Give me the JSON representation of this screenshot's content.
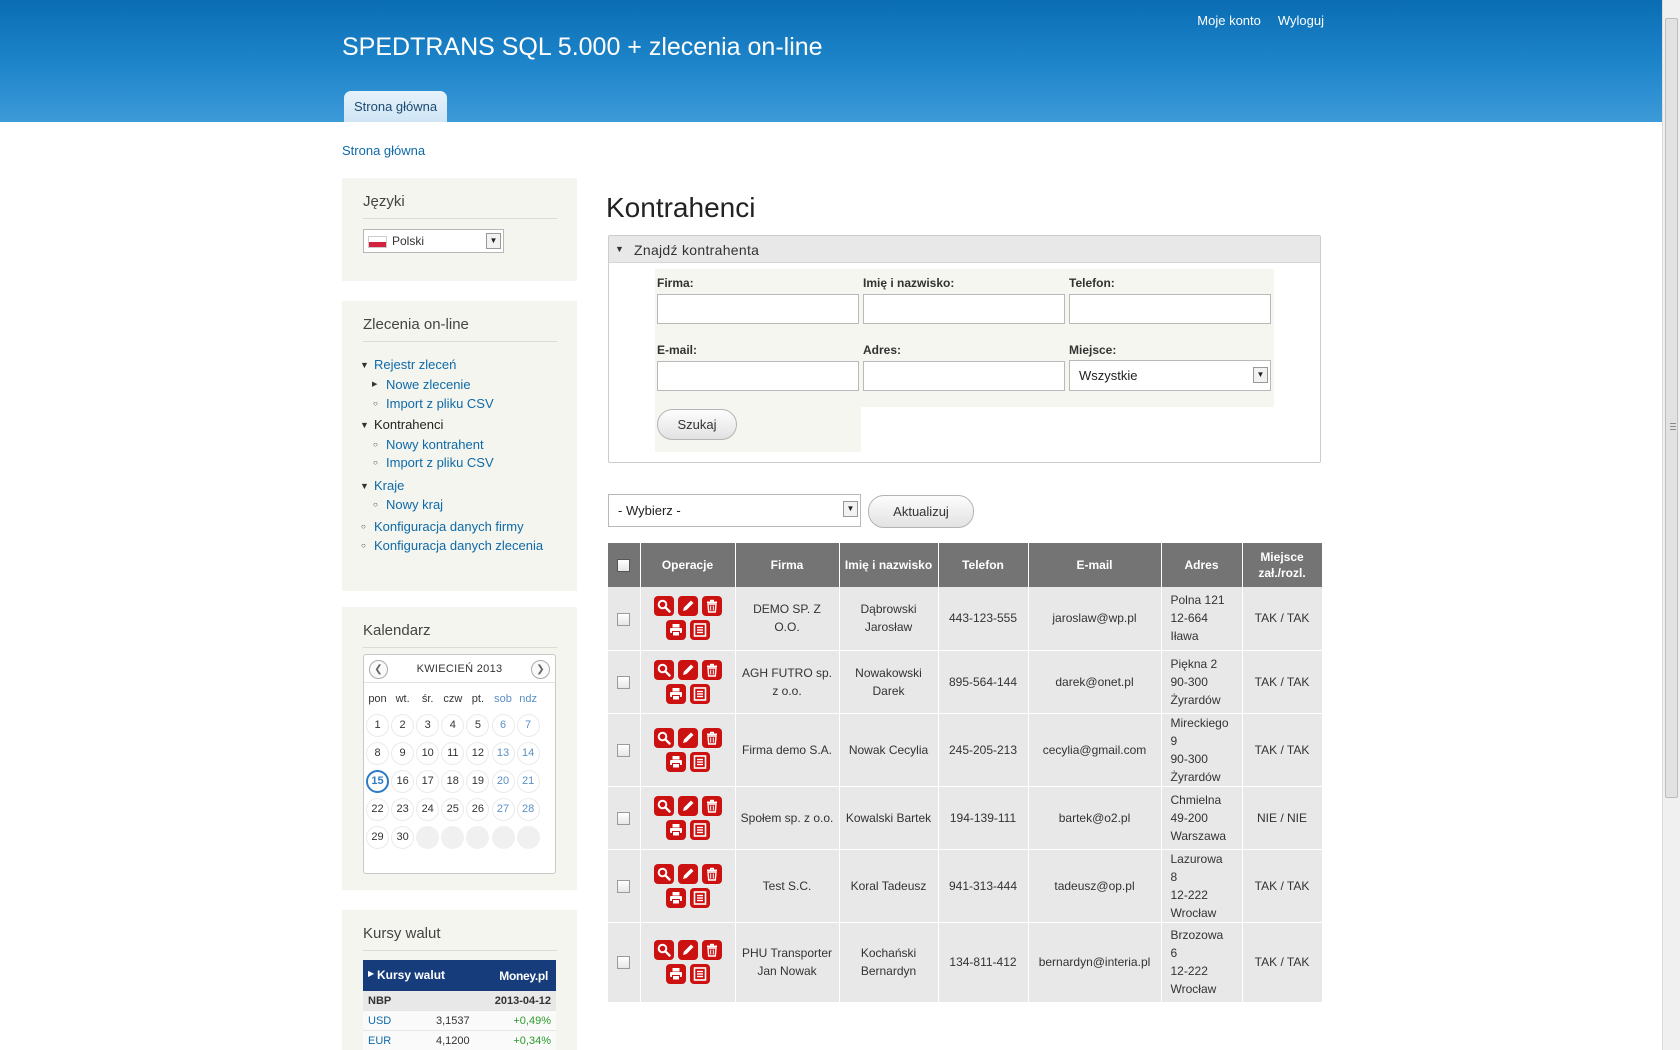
{
  "header": {
    "site_title": "SPEDTRANS SQL 5.000 + zlecenia on-line",
    "user_menu": [
      "Moje konto",
      "Wyloguj"
    ],
    "primary_tab": "Strona główna"
  },
  "breadcrumb": "Strona główna",
  "sidebar": {
    "languages": {
      "title": "Języki",
      "selected": "Polski"
    },
    "orders": {
      "title": "Zlecenia on-line",
      "items": [
        {
          "label": "Rejestr zleceń",
          "level": 0,
          "marker": "expanded",
          "link": true
        },
        {
          "label": "Nowe zlecenie",
          "level": 1,
          "marker": "collapsed",
          "link": true
        },
        {
          "label": "Import z pliku CSV",
          "level": 1,
          "marker": "leaf",
          "link": true
        },
        {
          "label": "Kontrahenci",
          "level": 0,
          "marker": "expanded",
          "link": false
        },
        {
          "label": "Nowy kontrahent",
          "level": 1,
          "marker": "leaf",
          "link": true
        },
        {
          "label": "Import z pliku CSV",
          "level": 1,
          "marker": "leaf",
          "link": true
        },
        {
          "label": "Kraje",
          "level": 0,
          "marker": "expanded",
          "link": true
        },
        {
          "label": "Nowy kraj",
          "level": 1,
          "marker": "leaf",
          "link": true
        },
        {
          "label": "Konfiguracja danych firmy",
          "level": 0,
          "marker": "leaf",
          "link": true
        },
        {
          "label": "Konfiguracja danych zlecenia",
          "level": 0,
          "marker": "leaf",
          "link": true
        }
      ]
    },
    "calendar": {
      "title": "Kalendarz",
      "month": "KWIECIEŃ 2013",
      "weekdays": [
        "pon",
        "wt.",
        "śr.",
        "czw",
        "pt.",
        "sob",
        "ndz"
      ],
      "days_in_month": 30,
      "first_weekday_index": 0,
      "today": 15
    },
    "exchange_rates": {
      "title": "Kursy walut",
      "widget_title": "Kursy walut",
      "brand": "Money.pl",
      "source": "NBP",
      "date": "2013-04-12",
      "rows": [
        {
          "currency": "USD",
          "rate": "3,1537",
          "change": "+0,49%"
        },
        {
          "currency": "EUR",
          "rate": "4,1200",
          "change": "+0,34%"
        }
      ],
      "up_color": "#2a9a2a"
    }
  },
  "main": {
    "heading": "Kontrahenci",
    "filter": {
      "legend": "Znajdź kontrahenta",
      "labels": {
        "company": "Firma:",
        "name": "Imię i nazwisko:",
        "phone": "Telefon:",
        "email": "E-mail:",
        "address": "Adres:",
        "place": "Miejsce:"
      },
      "values": {
        "company": "",
        "name": "",
        "phone": "",
        "email": "",
        "address": ""
      },
      "place_selected": "Wszystkie",
      "search_button": "Szukaj"
    },
    "bulk": {
      "selected": "- Wybierz -",
      "update_button": "Aktualizuj"
    },
    "table": {
      "columns": [
        "Operacje",
        "Firma",
        "Imię i nazwisko",
        "Telefon",
        "E-mail",
        "Adres",
        "Miejsce zał./rozl."
      ],
      "rows": [
        {
          "company": "DEMO SP. Z O.O.",
          "name": "Dąbrowski Jarosław",
          "phone": "443-123-555",
          "email": "jaroslaw@wp.pl",
          "address": [
            "Polna 121",
            "12-664",
            "Iława"
          ],
          "place": "TAK / TAK"
        },
        {
          "company": "AGH FUTRO sp. z o.o.",
          "name": "Nowakowski Darek",
          "phone": "895-564-144",
          "email": "darek@onet.pl",
          "address": [
            "Piękna 2",
            "90-300",
            "Żyrardów"
          ],
          "place": "TAK / TAK"
        },
        {
          "company": "Firma demo S.A.",
          "name": "Nowak Cecylia",
          "phone": "245-205-213",
          "email": "cecylia@gmail.com",
          "address": [
            "Mireckiego",
            "9",
            "90-300",
            "Żyrardów"
          ],
          "place": "TAK / TAK"
        },
        {
          "company": "Społem sp. z o.o.",
          "name": "Kowalski Bartek",
          "phone": "194-139-111",
          "email": "bartek@o2.pl",
          "address": [
            "Chmielna",
            "49-200",
            "Warszawa"
          ],
          "place": "NIE / NIE"
        },
        {
          "company": "Test S.C.",
          "name": "Koral Tadeusz",
          "phone": "941-313-444",
          "email": "tadeusz@op.pl",
          "address": [
            "Lazurowa",
            "8",
            "12-222",
            "Wrocław"
          ],
          "place": "TAK / TAK"
        },
        {
          "company": "PHU Transporter Jan Nowak",
          "name": "Kochański Bernardyn",
          "phone": "134-811-412",
          "email": "bernardyn@interia.pl",
          "address": [
            "Brzozowa",
            "6",
            "12-222",
            "Wrocław"
          ],
          "place": "TAK / TAK"
        }
      ],
      "operations": [
        "search-icon",
        "edit-icon",
        "delete-icon",
        "print-icon",
        "document-icon"
      ]
    }
  },
  "colors": {
    "header": "#1a7fc4",
    "link": "#0e6aa8",
    "action_icon": "#cc1111",
    "table_header": "#747474"
  }
}
